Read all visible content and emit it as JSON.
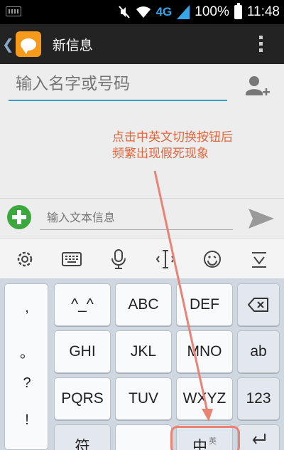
{
  "status_bar": {
    "network": "4G",
    "battery": "100%",
    "time": "11:48"
  },
  "action_bar": {
    "title": "新信息",
    "icons": [
      "back-chevron",
      "messaging-app-icon",
      "overflow-menu-icon"
    ]
  },
  "recipient": {
    "placeholder": "输入名字或号码"
  },
  "annotation": {
    "line1": "点击中英文切换按钮后",
    "line2": "频繁出现假死现象",
    "color": "#e0673f"
  },
  "compose": {
    "placeholder": "输入文本信息"
  },
  "ime_toolbar": {
    "icons": [
      "gear-icon",
      "keyboard-icon",
      "microphone-icon",
      "text-cursor-icon",
      "emoji-icon",
      "collapse-keyboard-icon"
    ]
  },
  "keyboard": {
    "punctuation": [
      ",",
      "。",
      "?",
      "!"
    ],
    "row1": [
      "^_^",
      "ABC",
      "DEF"
    ],
    "row2": [
      "GHI",
      "JKL",
      "MNO"
    ],
    "row3": [
      "PQRS",
      "TUV",
      "WXYZ"
    ],
    "right_keys": [
      "ab",
      "123"
    ],
    "bottom_left": "符",
    "bottom_mid": "中",
    "bottom_mid_sub": "英"
  },
  "colors": {
    "accent_blue": "#33a0c8",
    "send_green": "#3aa83c",
    "app_orange": "#f59a1a",
    "annotation_red": "#e0673f"
  }
}
